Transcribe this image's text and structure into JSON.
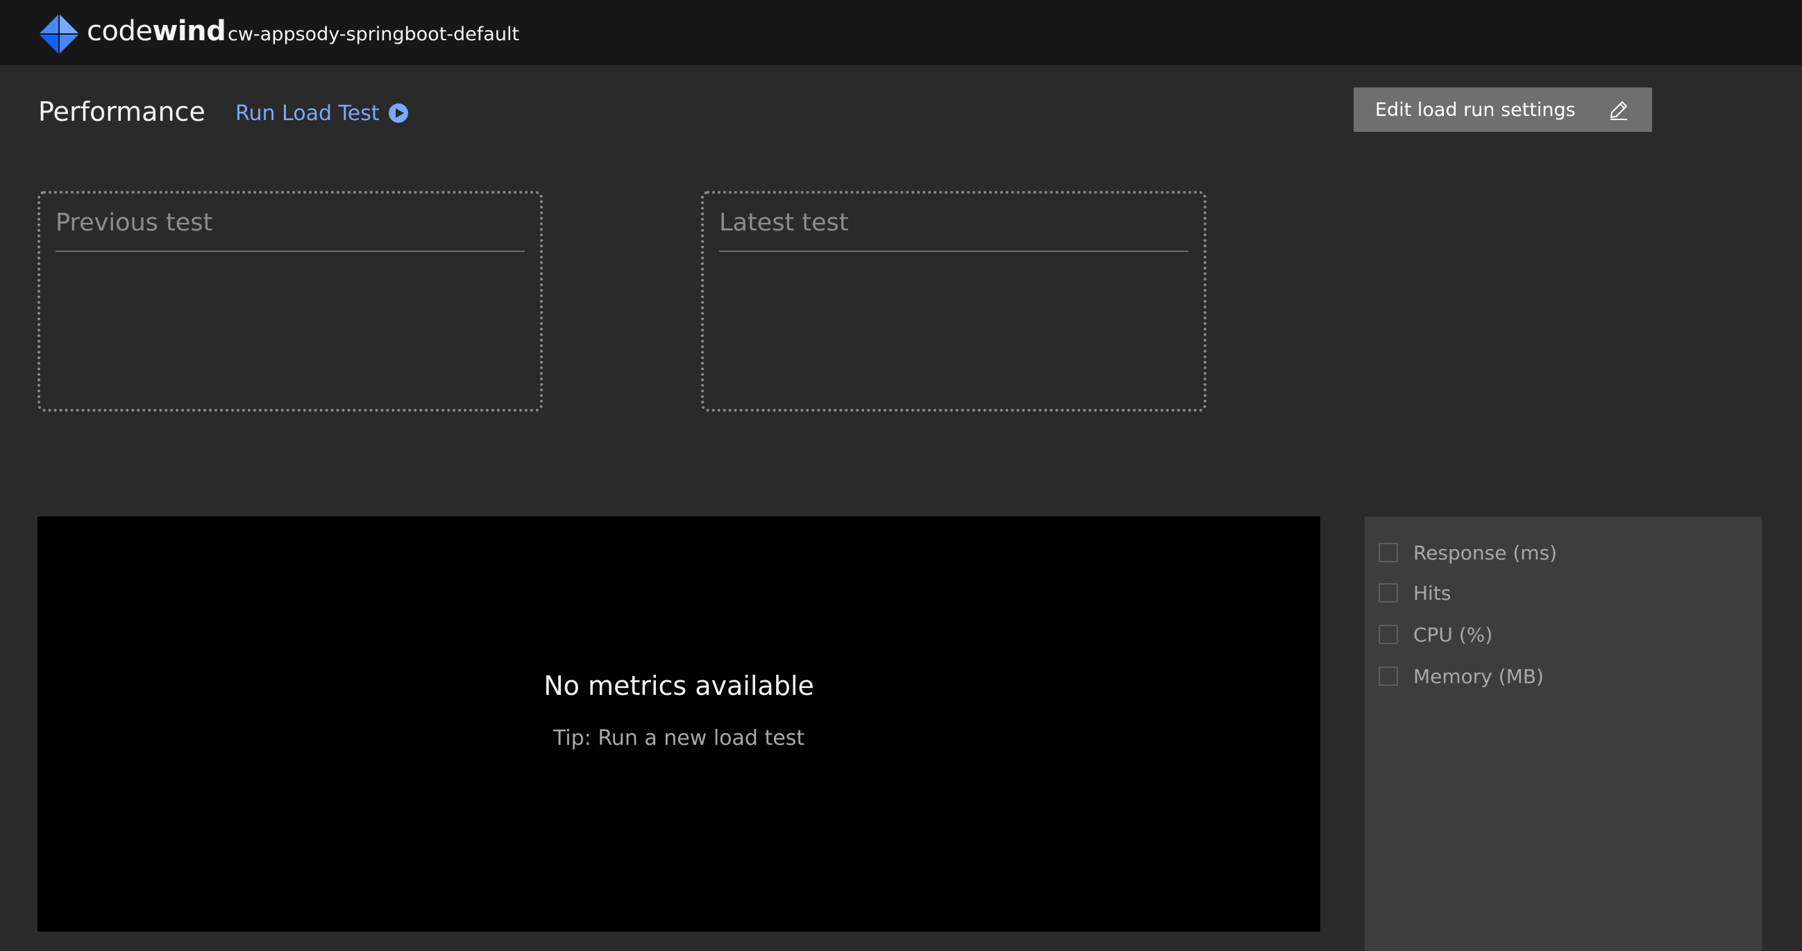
{
  "header": {
    "brand_light": "code",
    "brand_bold": "wind",
    "project_name": "cw-appsody-springboot-default",
    "logo_icon": "codewind-logo-icon",
    "logo_color": "#4589ff"
  },
  "main": {
    "title": "Performance",
    "run_load_test_label": "Run Load Test",
    "run_icon": "play-circle-icon",
    "edit_settings_label": "Edit load run settings",
    "edit_icon": "pencil-icon"
  },
  "tests": {
    "previous_label": "Previous test",
    "latest_label": "Latest test"
  },
  "chart": {
    "empty_message": "No metrics available",
    "tip": "Tip: Run a new load test"
  },
  "legend": {
    "items": [
      {
        "label": "Response (ms)",
        "checked": false
      },
      {
        "label": "Hits",
        "checked": false
      },
      {
        "label": "CPU (%)",
        "checked": false
      },
      {
        "label": "Memory (MB)",
        "checked": false
      }
    ]
  },
  "colors": {
    "link": "#78a9ff",
    "background": "#2a2a2a",
    "topbar": "#171717"
  }
}
